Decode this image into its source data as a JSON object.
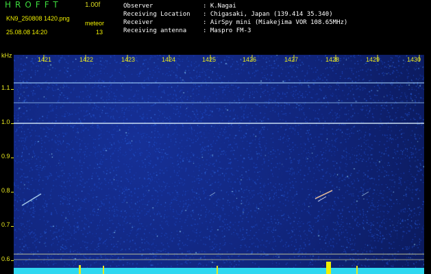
{
  "header": {
    "app_title": "HROFFT",
    "version": "1.00f",
    "filename": "KN9_250808 1420.png",
    "meteor_label": "meteor",
    "timestamp": "25.08.08 14:20",
    "meteor_count": "13",
    "fields": [
      {
        "label": "Observer",
        "value": ": K.Nagai"
      },
      {
        "label": "Receiving Location",
        "value": ": Chigasaki, Japan (139.414 35.340)"
      },
      {
        "label": "Receiver",
        "value": ": AirSpy mini (Miakejima VOR 108.65MHz)"
      },
      {
        "label": "Receiving antenna",
        "value": ": Maspro FM-3"
      }
    ]
  },
  "plot": {
    "unit": "kHz",
    "x_ticks": [
      "1421",
      "1422",
      "1423",
      "1424",
      "1425",
      "1426",
      "1427",
      "1428",
      "1429",
      "1430"
    ],
    "y_ticks": [
      "1.1",
      "1.0",
      "0.9",
      "0.8",
      "0.7",
      "0.6"
    ],
    "colors": {
      "background": "#10247a",
      "noise": "#2a5ad0",
      "carrier": "#c8e8ff",
      "baseline": "#30e0ff",
      "axis": "#e8e820"
    }
  }
}
